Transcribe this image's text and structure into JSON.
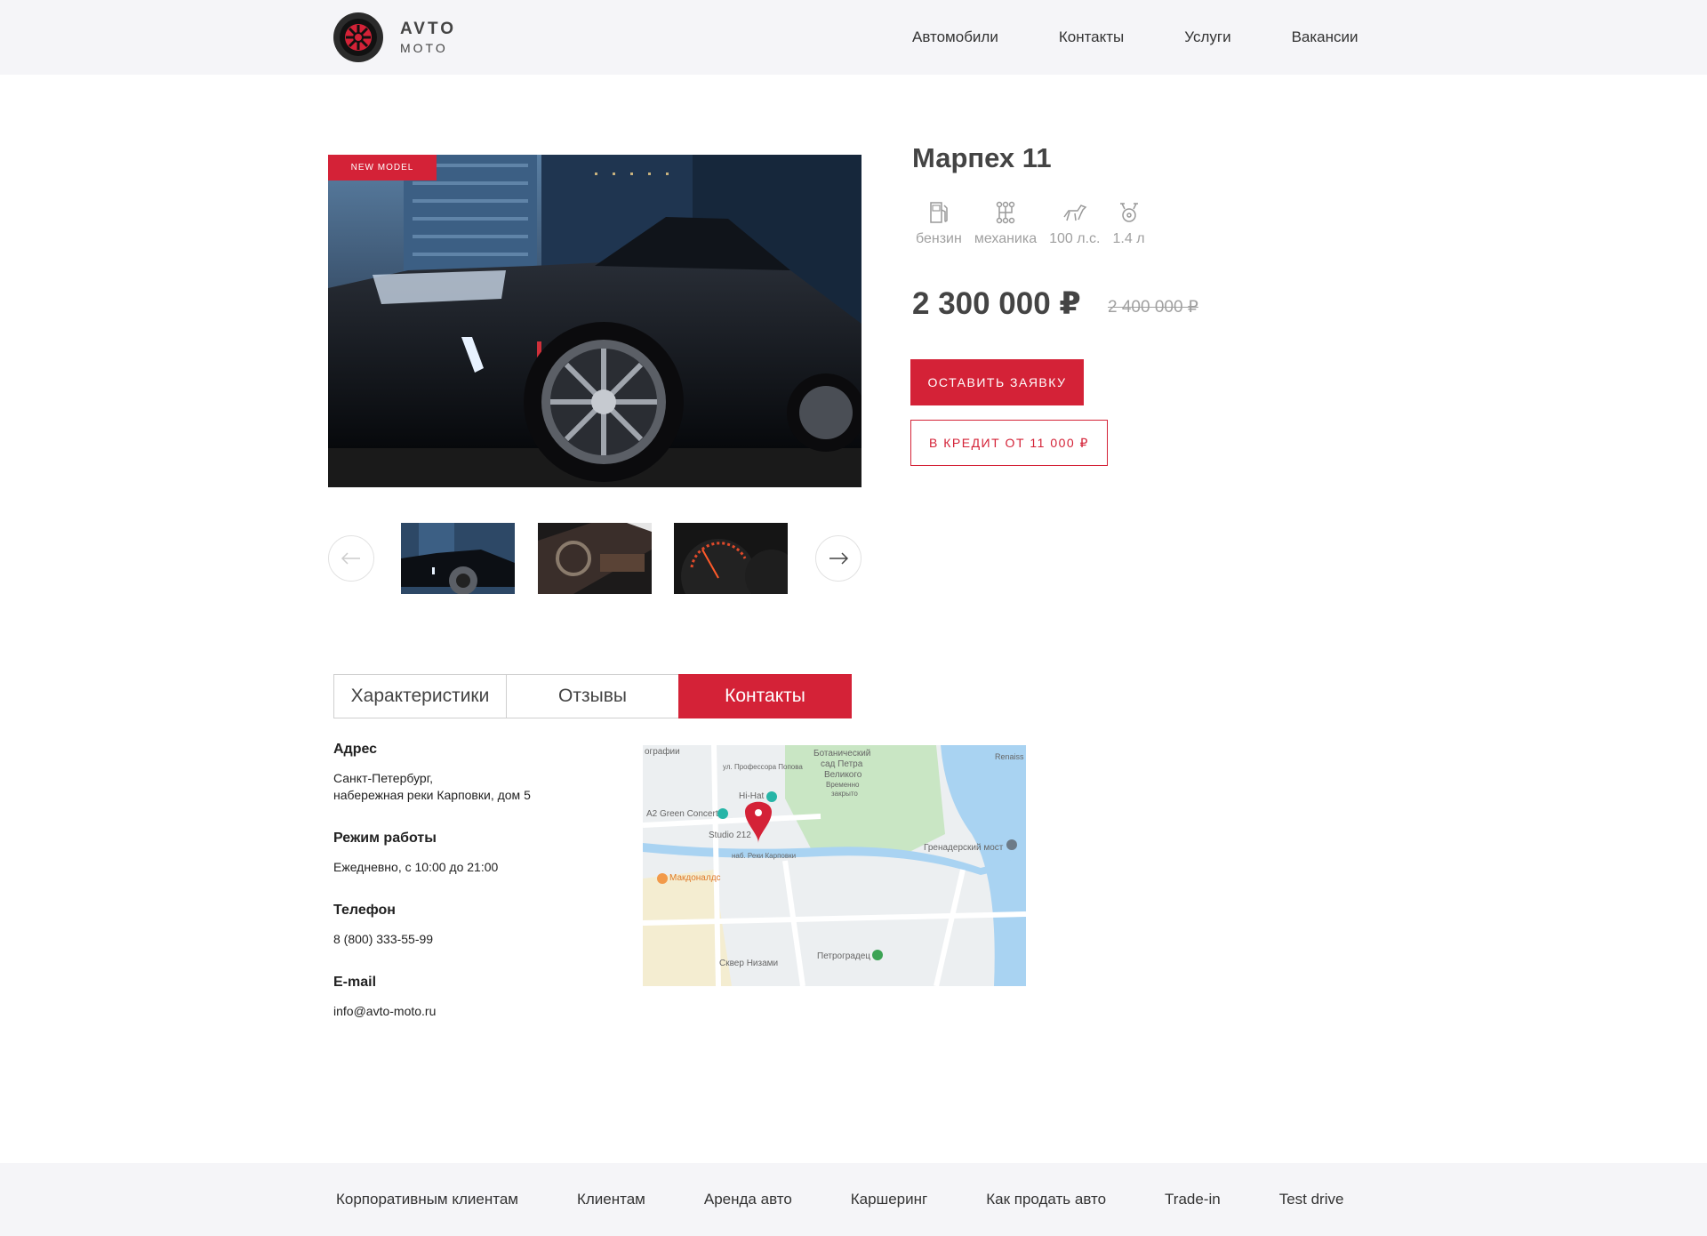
{
  "header": {
    "logo": {
      "line1": "AVTO",
      "line2": "MOTO"
    },
    "nav": [
      "Автомобили",
      "Контакты",
      "Услуги",
      "Вакансии"
    ]
  },
  "product": {
    "badge": "NEW MODEL",
    "title": "Марпех 11",
    "specs": [
      {
        "icon": "fuel-icon",
        "label": "бензин"
      },
      {
        "icon": "gearbox-icon",
        "label": "механика"
      },
      {
        "icon": "horse-icon",
        "label": "100 л.с."
      },
      {
        "icon": "engine-icon",
        "label": "1.4 л"
      }
    ],
    "price": "2 300 000 ₽",
    "old_price": "2 400 000 ₽",
    "order_button": "ОСТАВИТЬ ЗАЯВКУ",
    "credit_button": "В КРЕДИТ ОТ 11 000 ₽"
  },
  "tabs": {
    "items": [
      "Характеристики",
      "Отзывы",
      "Контакты"
    ],
    "active": "Контакты"
  },
  "contacts": {
    "address_label": "Адрес",
    "address_line1": "Санкт-Петербург,",
    "address_line2": "набережная реки Карповки, дом 5",
    "hours_label": "Режим работы",
    "hours": "Ежедневно, с 10:00 до 21:00",
    "phone_label": "Телефон",
    "phone": "8 (800) 333-55-99",
    "email_label": "E-mail",
    "email": "info@avto-moto.ru"
  },
  "map": {
    "labels": [
      "ографии",
      "Ботанический",
      "сад Петра",
      "Великого",
      "Временно",
      "закрыто",
      "Hi-Hat",
      "A2 Green Concert",
      "Studio 212",
      "наб. Реки Карповки",
      "Гренадерский мост",
      "Макдоналдс",
      "Петроградец",
      "Сквер Низами",
      "Renaiss",
      "ул. Профессора Попова"
    ]
  },
  "footer": {
    "links": [
      "Корпоративным клиентам",
      "Клиентам",
      "Аренда авто",
      "Каршеринг",
      "Как продать авто",
      "Trade-in",
      "Test drive"
    ]
  },
  "colors": {
    "accent": "#d42237",
    "header_bg": "#f5f5f8",
    "text": "#333333",
    "muted": "#a0a0a0"
  }
}
